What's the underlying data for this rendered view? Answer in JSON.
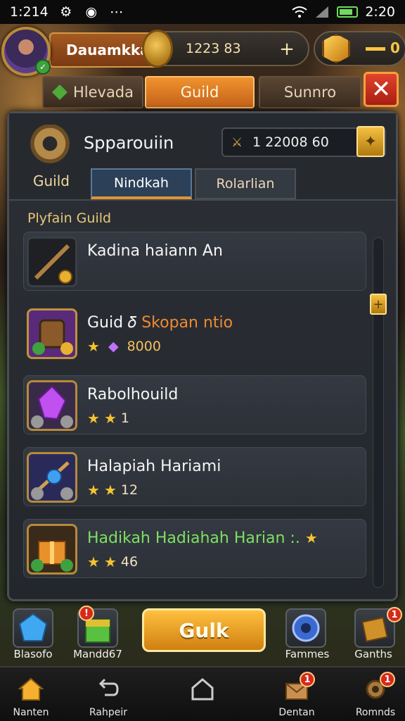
{
  "status_bar": {
    "time_left": "1:214",
    "time_right": "2:20"
  },
  "hud": {
    "player_name": "Dauamkka",
    "coins": "1223 83",
    "plus": "+",
    "gems": "0"
  },
  "top_tabs": [
    {
      "label": "Hlevada"
    },
    {
      "label": "Guild"
    },
    {
      "label": "Sunnro"
    }
  ],
  "close_label": "✕",
  "panel": {
    "guild_label": "Guild",
    "title": "Spparouiin",
    "resource_value": "1 22008 60",
    "subtabs": [
      {
        "label": "Nindkah"
      },
      {
        "label": "Rolarlian"
      }
    ],
    "section_title": "Plyfain Guild"
  },
  "items": [
    {
      "name": "Kadina  haiann An",
      "sub": ""
    },
    {
      "name": "Guid 𝛿",
      "name_accent": "Skopan ntio",
      "sub": "8000"
    },
    {
      "name": "Rabolhouild",
      "sub": "1"
    },
    {
      "name": "Halapiah Hariami",
      "sub": "12"
    },
    {
      "name": "Hadikah Hadiahah Harian :.",
      "sub": "46"
    }
  ],
  "actions": [
    {
      "label": "Blasofo"
    },
    {
      "label": "Mandd67"
    },
    {
      "label": "Gulk"
    },
    {
      "label": "Fammes"
    },
    {
      "label": "Ganths"
    }
  ],
  "nav": [
    {
      "label": "Nanten"
    },
    {
      "label": "Rahpeir"
    },
    {
      "label": ""
    },
    {
      "label": "Dentan"
    },
    {
      "label": "Romnds"
    }
  ],
  "badges": {
    "act_mandd": "!",
    "act_ganths": "1",
    "nav_dentan": "1",
    "nav_romnds": "1"
  }
}
